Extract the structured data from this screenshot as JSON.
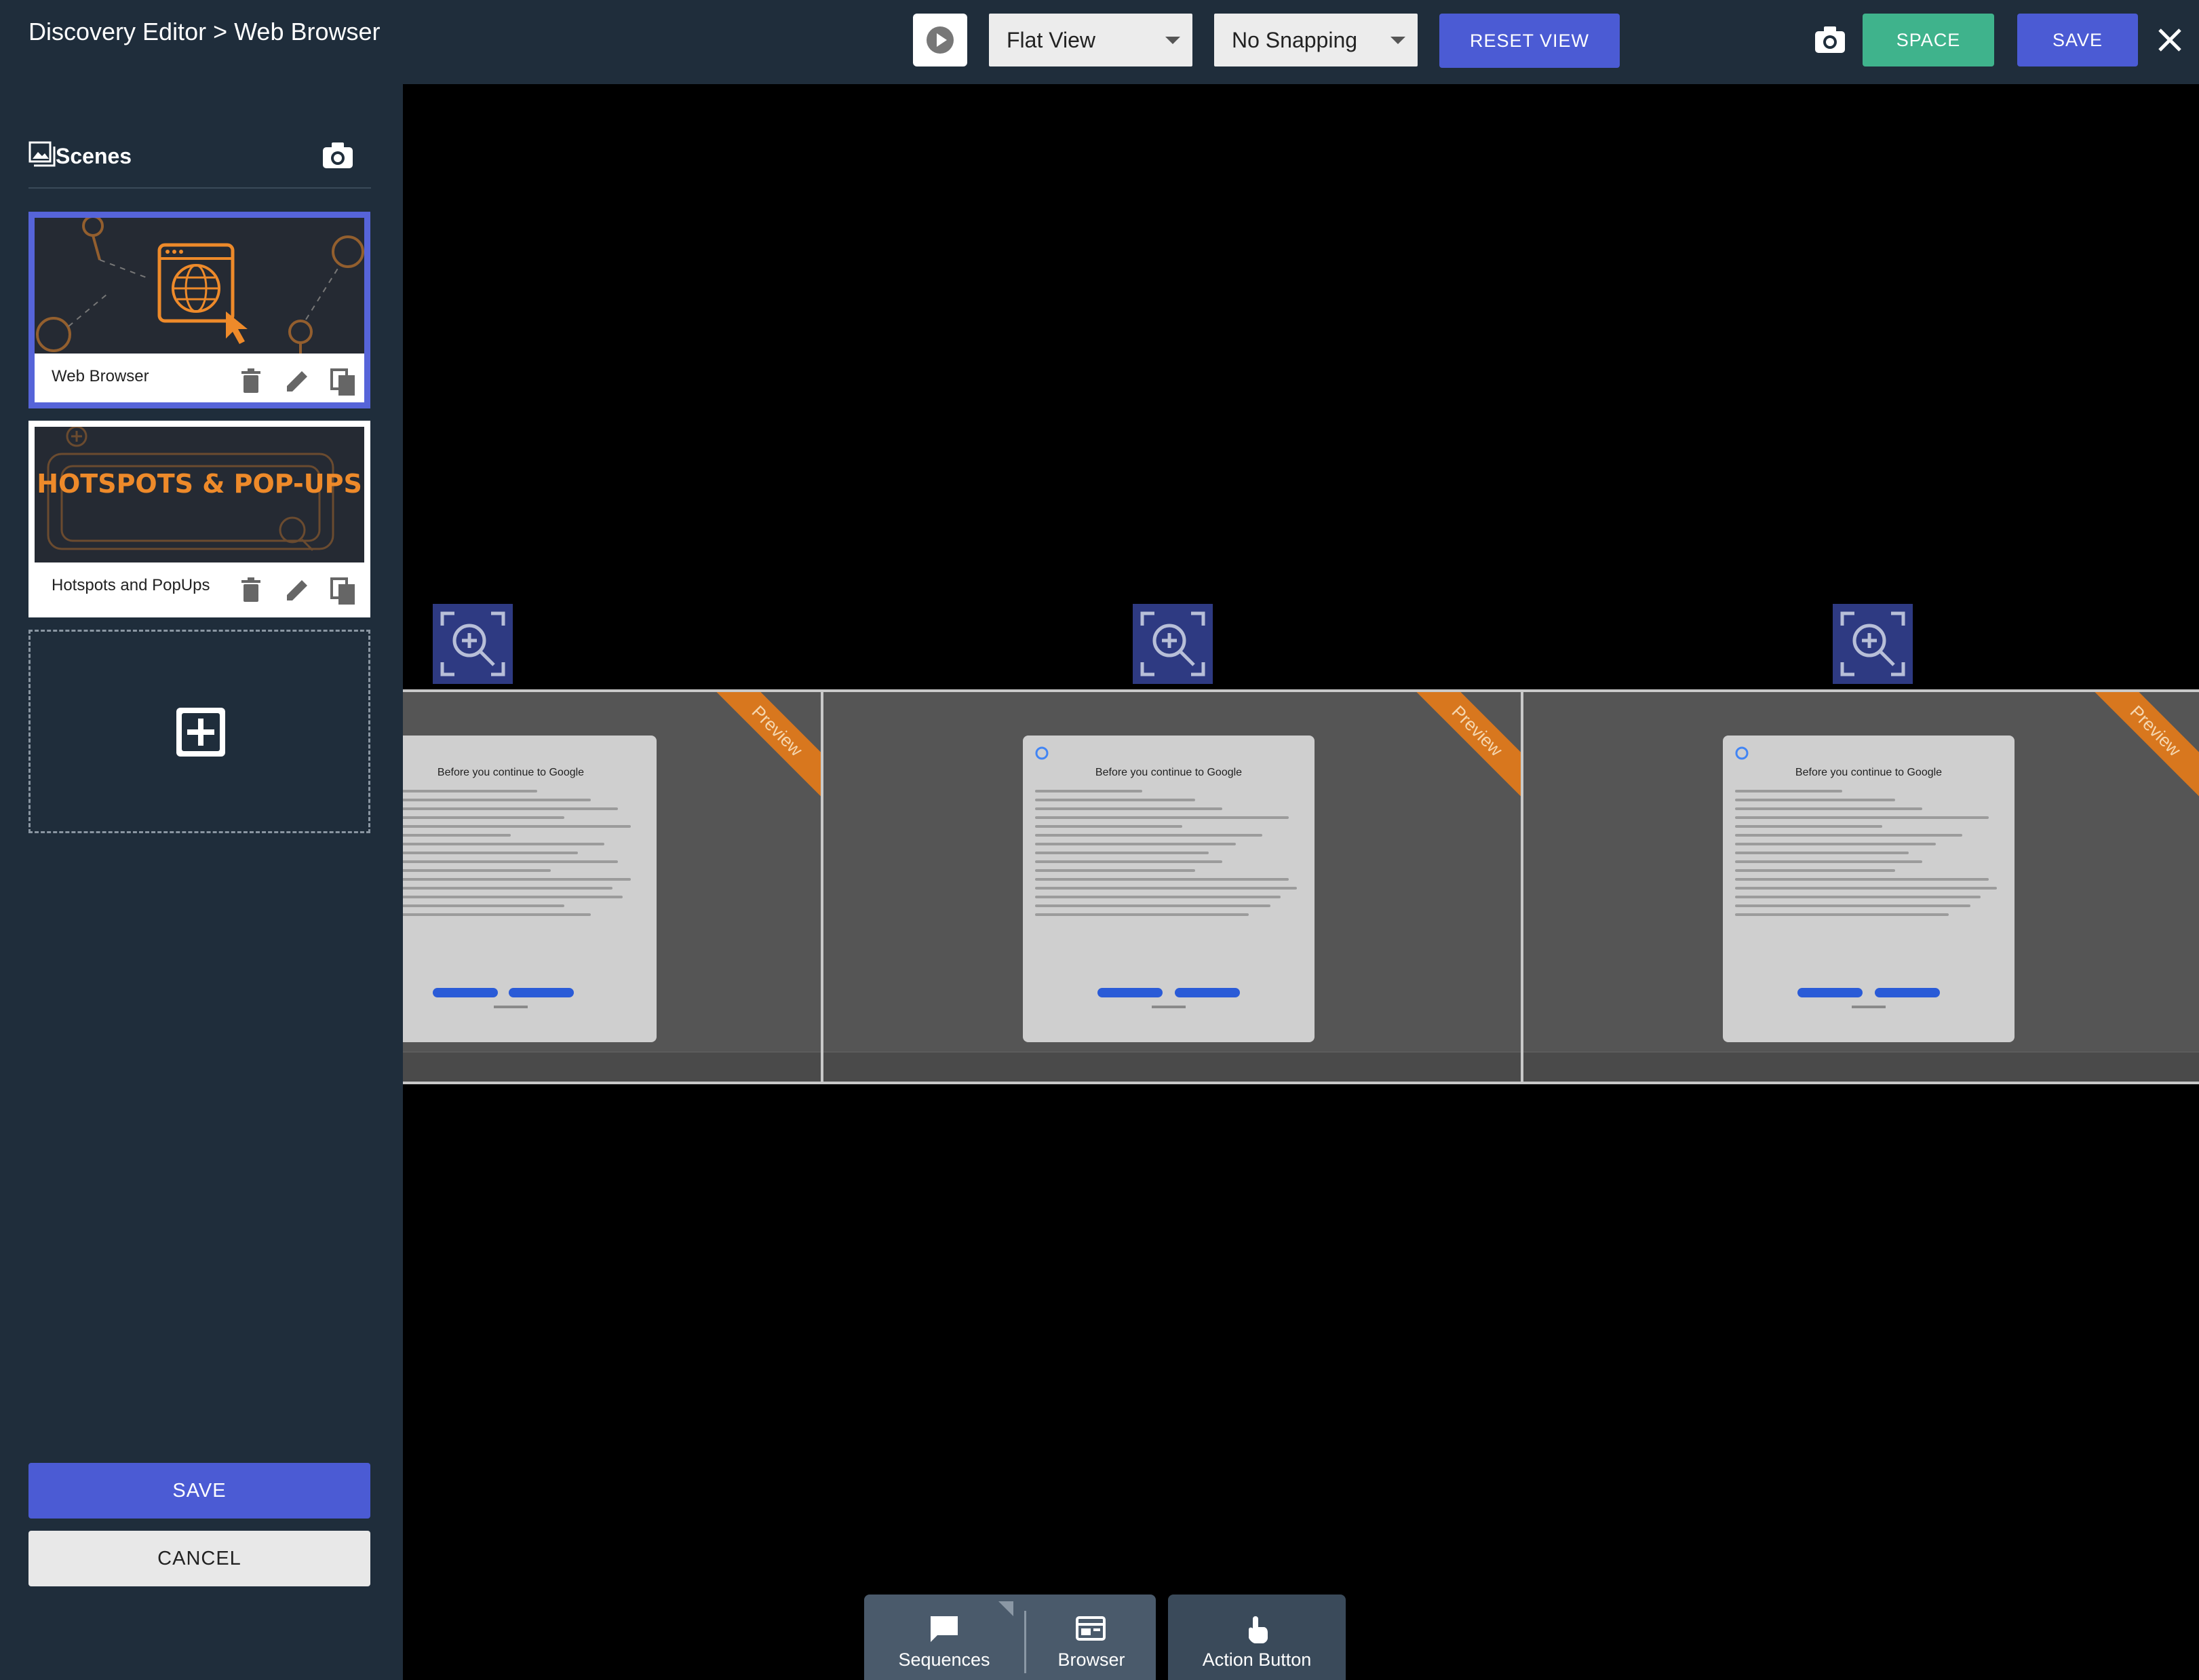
{
  "header": {
    "breadcrumb": "Discovery Editor > Web Browser",
    "view_select": "Flat View",
    "snapping_select": "No Snapping",
    "reset_view": "RESET VIEW",
    "space": "SPACE",
    "save": "SAVE",
    "icons": [
      "play-icon",
      "camera-icon",
      "close-icon"
    ]
  },
  "sidebar": {
    "title": "Scenes",
    "scenes": [
      {
        "label": "Web Browser",
        "selected": true
      },
      {
        "label": "Hotspots and PopUps",
        "thumb_text": "HOTSPOTS & POP-UPS",
        "selected": false
      }
    ],
    "save": "SAVE",
    "cancel": "CANCEL"
  },
  "canvas": {
    "preview_label": "Preview",
    "dialog_title": "Before you continue to Google",
    "panels": 3
  },
  "toolbar": {
    "sequences": "Sequences",
    "browser": "Browser",
    "action_button": "Action Button"
  },
  "colors": {
    "bar": "#1f2d3b",
    "accent": "#4b5bd4",
    "space": "#3fb38c",
    "ribbon": "#d8771e"
  }
}
